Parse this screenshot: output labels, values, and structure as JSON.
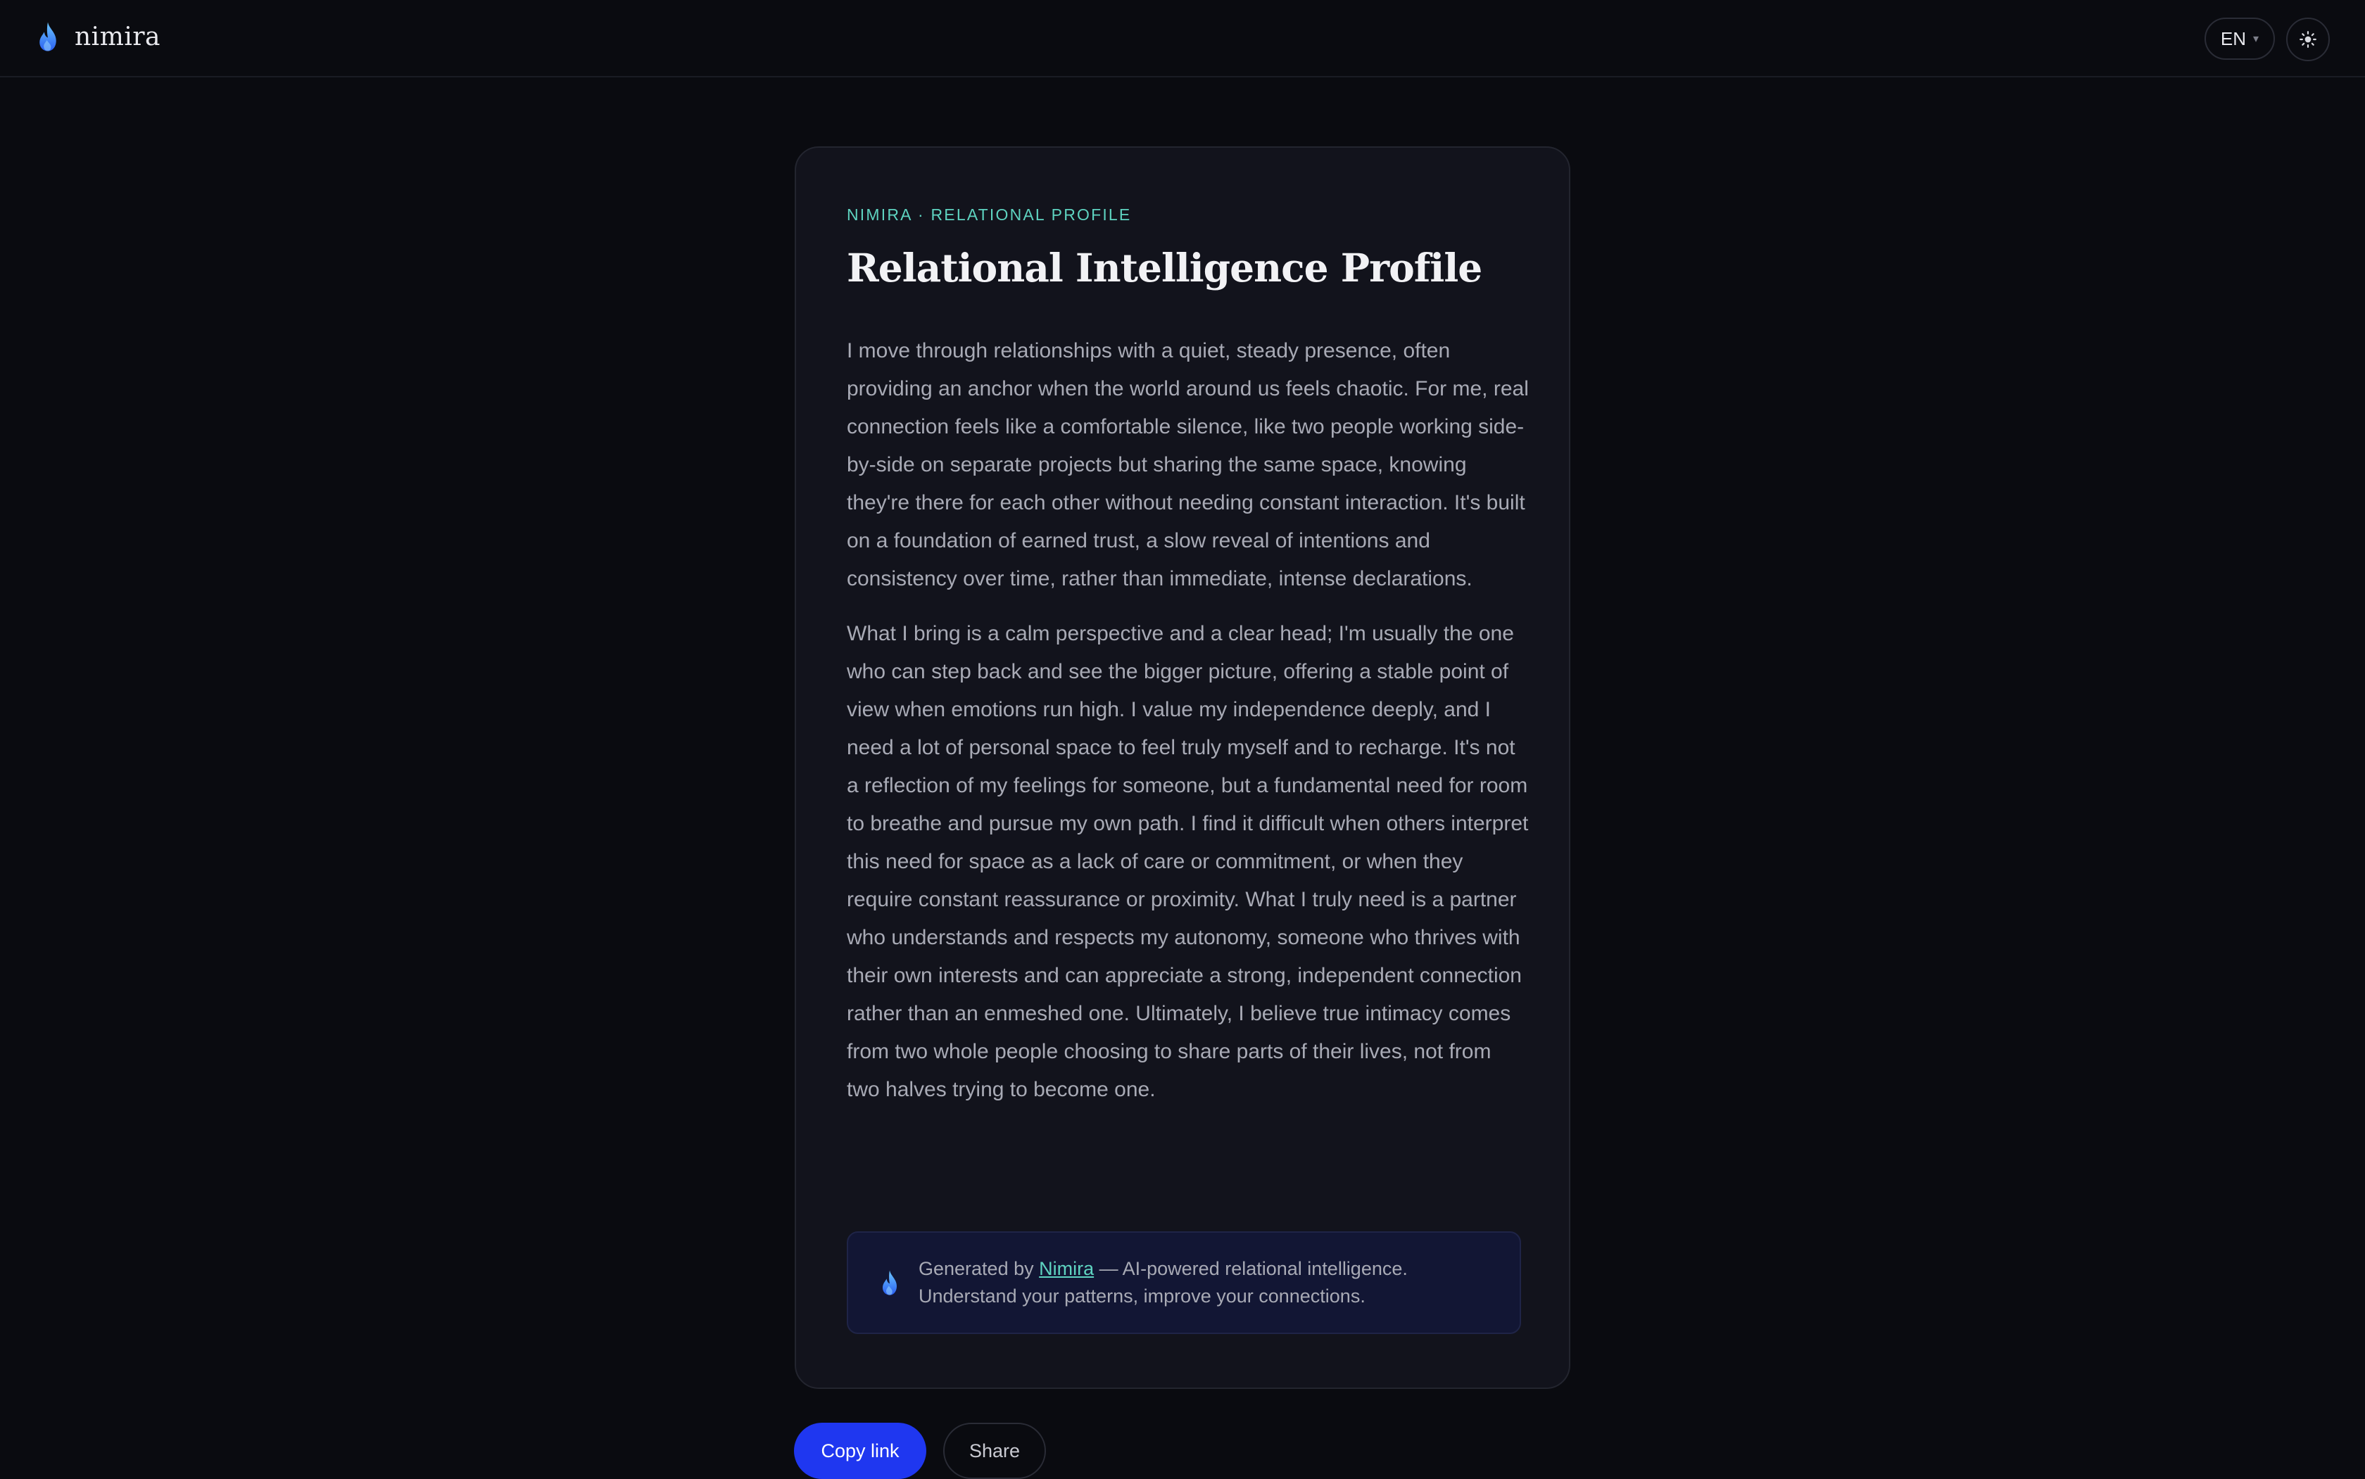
{
  "header": {
    "brand_name": "nimira",
    "language": "EN",
    "icons": {
      "logo": "flame-icon",
      "language_menu": "chevron-down-icon",
      "theme": "sun-icon"
    }
  },
  "colors": {
    "background": "#0a0b10",
    "card": "#12131c",
    "accent_teal": "#5ed3c0",
    "button_primary": "#1f37f0",
    "flame_gradient": [
      "#4db8ff",
      "#2a5ef0"
    ]
  },
  "card": {
    "eyebrow": "NIMIRA · RELATIONAL PROFILE",
    "title": "Relational Intelligence Profile",
    "paragraphs": [
      "I move through relationships with a quiet, steady presence, often providing an anchor when the world around us feels chaotic. For me, real connection feels like a comfortable silence, like two people working side-by-side on separate projects but sharing the same space, knowing they're there for each other without needing constant interaction. It's built on a foundation of earned trust, a slow reveal of intentions and consistency over time, rather than immediate, intense declarations.",
      "What I bring is a calm perspective and a clear head; I'm usually the one who can step back and see the bigger picture, offering a stable point of view when emotions run high. I value my independence deeply, and I need a lot of personal space to feel truly myself and to recharge. It's not a reflection of my feelings for someone, but a fundamental need for room to breathe and pursue my own path. I find it difficult when others interpret this need for space as a lack of care or commitment, or when they require constant reassurance or proximity. What I truly need is a partner who understands and respects my autonomy, someone who thrives with their own interests and can appreciate a strong, independent connection rather than an enmeshed one. Ultimately, I believe true intimacy comes from two whole people choosing to share parts of their lives, not from two halves trying to become one."
    ],
    "footer": {
      "prefix": "Generated by ",
      "link": "Nimira",
      "suffix": " — AI-powered relational intelligence.",
      "line2": "Understand your patterns, improve your connections."
    }
  },
  "actions": {
    "copy_link": "Copy link",
    "share": "Share"
  }
}
